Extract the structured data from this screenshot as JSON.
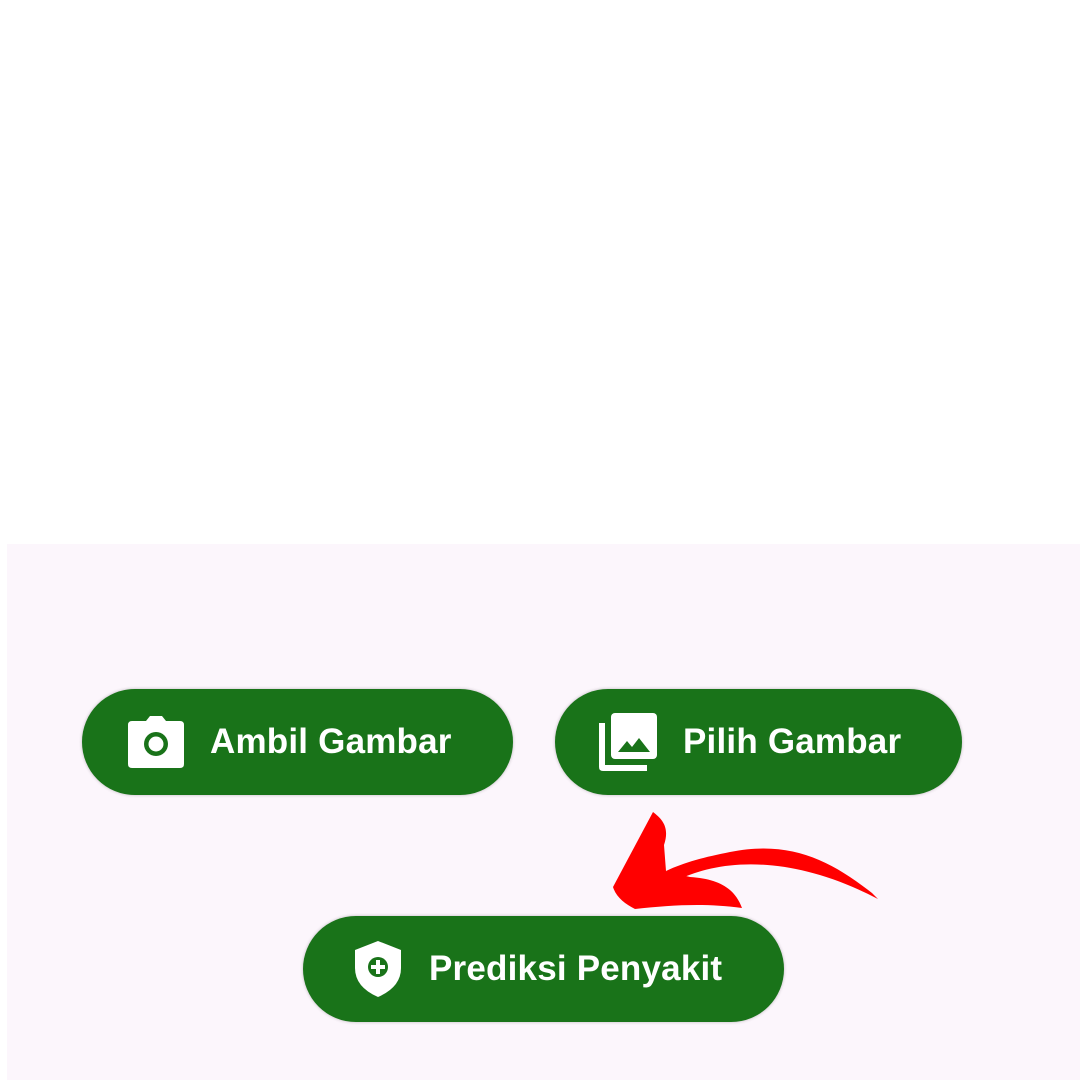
{
  "colors": {
    "button_green": "#197319",
    "panel_background": "#fcf6fc",
    "arrow_red": "#ff0000"
  },
  "buttons": {
    "ambil_gambar": {
      "label": "Ambil Gambar",
      "icon": "camera-icon"
    },
    "pilih_gambar": {
      "label": "Pilih Gambar",
      "icon": "image-library-icon"
    },
    "prediksi_penyakit": {
      "label": "Prediksi Penyakit",
      "icon": "shield-plus-icon"
    }
  },
  "annotation": {
    "icon": "curved-arrow-icon"
  }
}
